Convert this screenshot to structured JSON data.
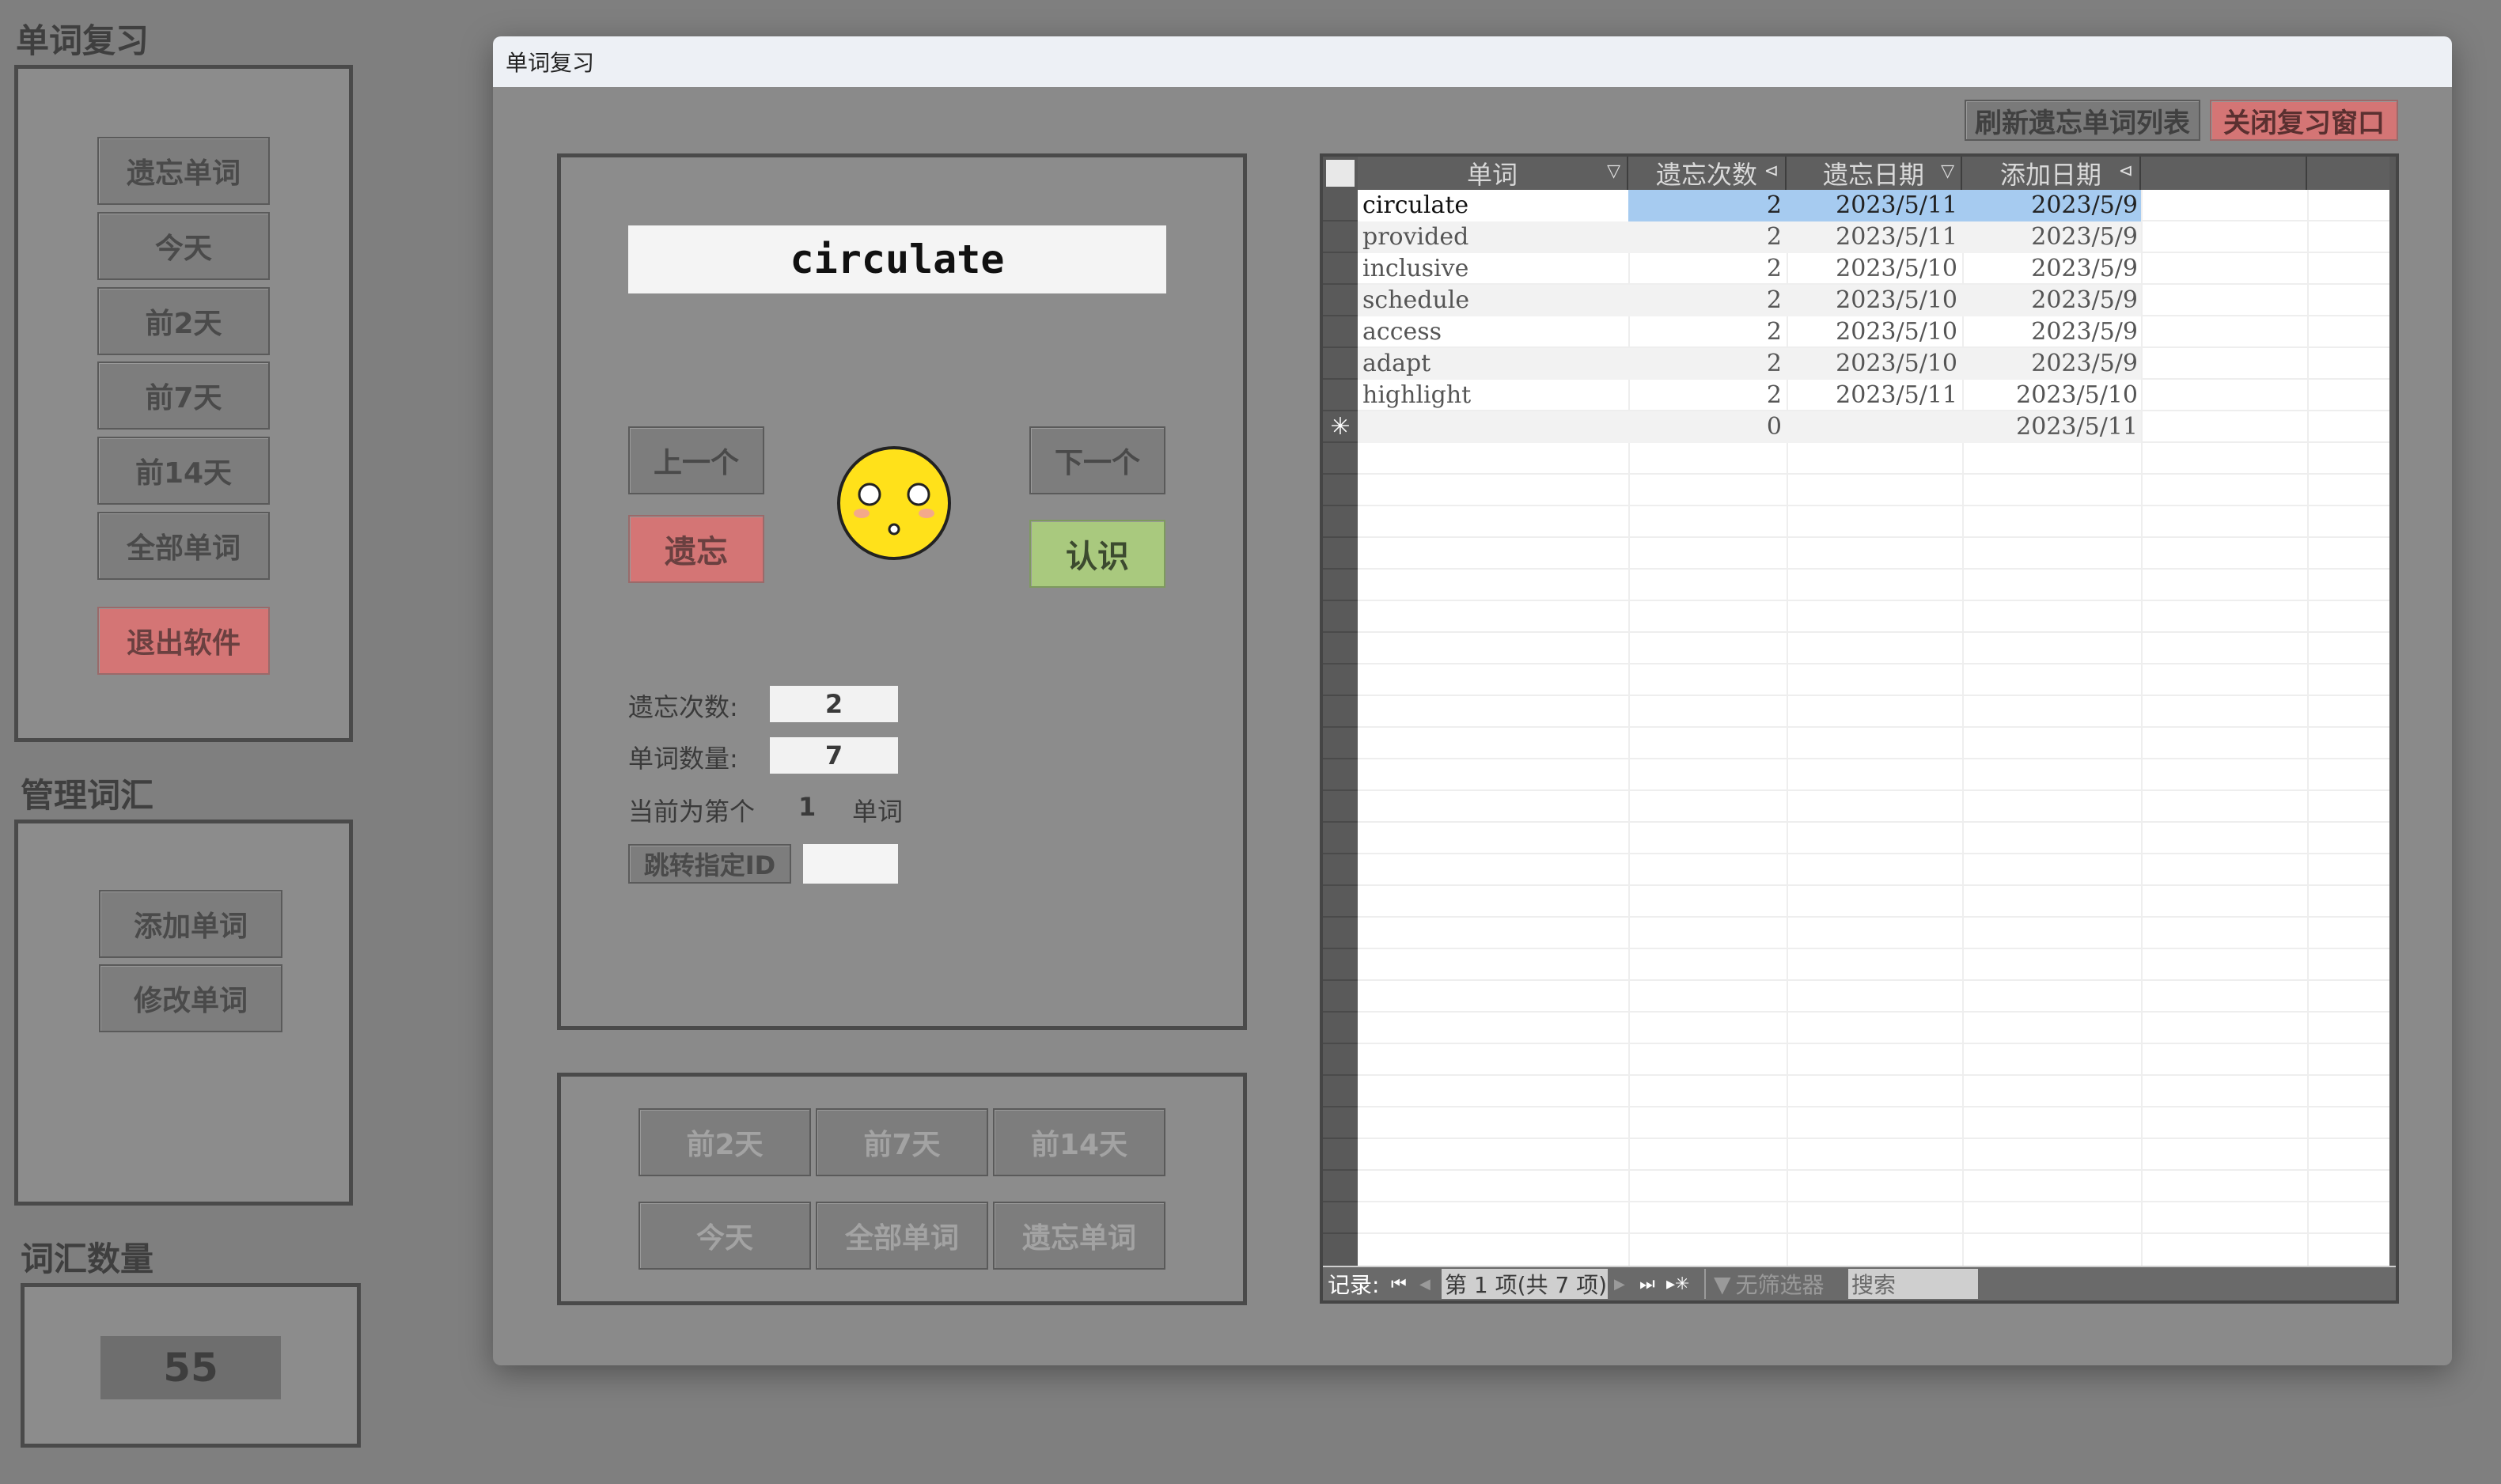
{
  "sidebar": {
    "review": {
      "title": "单词复习",
      "buttons": [
        "遗忘单词",
        "今天",
        "前2天",
        "前7天",
        "前14天",
        "全部单词"
      ],
      "exit_label": "退出软件"
    },
    "manage": {
      "title": "管理词汇",
      "buttons": [
        "添加单词",
        "修改单词"
      ]
    },
    "count": {
      "title": "词汇数量",
      "value": "55"
    }
  },
  "dialog": {
    "title": "单词复习",
    "refresh_label": "刷新遗忘单词列表",
    "close_label": "关闭复习窗口",
    "card": {
      "word": "circulate",
      "prev_label": "上一个",
      "next_label": "下一个",
      "forget_label": "遗忘",
      "know_label": "认识",
      "forget_count_label": "遗忘次数:",
      "forget_count_value": "2",
      "word_count_label": "单词数量:",
      "word_count_value": "7",
      "current_prefix": "当前为第个",
      "current_index": "1",
      "current_suffix": "单词",
      "jump_label": "跳转指定ID",
      "jump_value": ""
    },
    "filters": {
      "row1": [
        "前2天",
        "前7天",
        "前14天"
      ],
      "row2": [
        "今天",
        "全部单词",
        "遗忘单词"
      ]
    },
    "table": {
      "columns": [
        "单词",
        "遗忘次数",
        "遗忘日期",
        "添加日期"
      ],
      "rows": [
        {
          "word": "circulate",
          "count": "2",
          "forget_date": "2023/5/11",
          "add_date": "2023/5/9"
        },
        {
          "word": "provided",
          "count": "2",
          "forget_date": "2023/5/11",
          "add_date": "2023/5/9"
        },
        {
          "word": "inclusive",
          "count": "2",
          "forget_date": "2023/5/10",
          "add_date": "2023/5/9"
        },
        {
          "word": "schedule",
          "count": "2",
          "forget_date": "2023/5/10",
          "add_date": "2023/5/9"
        },
        {
          "word": "access",
          "count": "2",
          "forget_date": "2023/5/10",
          "add_date": "2023/5/9"
        },
        {
          "word": "adapt",
          "count": "2",
          "forget_date": "2023/5/10",
          "add_date": "2023/5/9"
        },
        {
          "word": "highlight",
          "count": "2",
          "forget_date": "2023/5/11",
          "add_date": "2023/5/10"
        }
      ],
      "new_row": {
        "marker": "✳",
        "count": "0",
        "add_date": "2023/5/11"
      },
      "nav": {
        "record_label": "记录:",
        "position": "第 1 项(共 7 项)",
        "filter_label": "无筛选器",
        "search_placeholder": "搜索"
      }
    }
  },
  "colors": {
    "background": "#7f7f7f",
    "danger": "#d47575",
    "success": "#a9c97e",
    "selection": "#a6cbf0",
    "emoji": "#ffe11a"
  }
}
